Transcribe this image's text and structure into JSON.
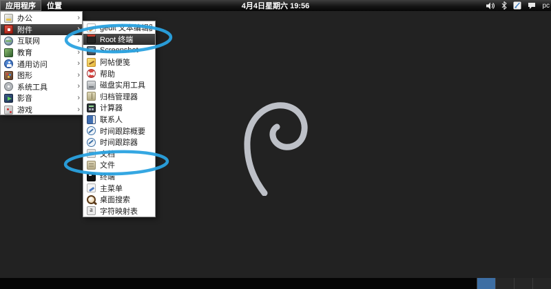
{
  "panel": {
    "applications_label": "应用程序",
    "places_label": "位置",
    "clock": "4月4日星期六 19:56",
    "tray": {
      "host_label": "pc",
      "icons": [
        "volume-icon",
        "bluetooth-icon",
        "input-pen-icon",
        "chat-icon"
      ]
    }
  },
  "desktop": {
    "logo": "debian-swirl-logo"
  },
  "menu": {
    "categories": [
      {
        "id": "office",
        "label": "办公",
        "icon": "office",
        "selected": false
      },
      {
        "id": "accessories",
        "label": "附件",
        "icon": "accessories",
        "selected": true
      },
      {
        "id": "internet",
        "label": "互联网",
        "icon": "internet",
        "selected": false
      },
      {
        "id": "education",
        "label": "教育",
        "icon": "education",
        "selected": false
      },
      {
        "id": "universal-access",
        "label": "通用访问",
        "icon": "universal-access",
        "selected": false
      },
      {
        "id": "graphics",
        "label": "图形",
        "icon": "graphics",
        "selected": false
      },
      {
        "id": "system-tools",
        "label": "系统工具",
        "icon": "system-tools",
        "selected": false
      },
      {
        "id": "sound-video",
        "label": "影音",
        "icon": "sound-video",
        "selected": false
      },
      {
        "id": "games",
        "label": "游戏",
        "icon": "games",
        "selected": false
      }
    ],
    "submenu": [
      {
        "id": "gedit-text-editor",
        "label": "gedit 文本编辑器",
        "icon": "gedit-text-editor",
        "selected": false
      },
      {
        "id": "root-terminal",
        "label": "Root 终端",
        "icon": "root-terminal",
        "selected": true
      },
      {
        "id": "screenshot",
        "label": "Screenshot",
        "icon": "screenshot",
        "selected": false
      },
      {
        "id": "xpad-notes",
        "label": "阿帖便笺",
        "icon": "xpad-notes",
        "selected": false
      },
      {
        "id": "help",
        "label": "帮助",
        "icon": "help",
        "selected": false
      },
      {
        "id": "disk-utility",
        "label": "磁盘实用工具",
        "icon": "disk-utility",
        "selected": false
      },
      {
        "id": "archive-manager",
        "label": "归档管理器",
        "icon": "archive-manager",
        "selected": false
      },
      {
        "id": "calculator",
        "label": "计算器",
        "icon": "calculator",
        "selected": false
      },
      {
        "id": "contacts",
        "label": "联系人",
        "icon": "contacts",
        "selected": false
      },
      {
        "id": "time-tracking-summary",
        "label": "时间跟踪概要",
        "icon": "time",
        "selected": false
      },
      {
        "id": "time-tracker",
        "label": "时间跟踪器",
        "icon": "time",
        "selected": false
      },
      {
        "id": "documents",
        "label": "文档",
        "icon": "documents",
        "selected": false
      },
      {
        "id": "files",
        "label": "文件",
        "icon": "files",
        "selected": false
      },
      {
        "id": "terminal",
        "label": "终端",
        "icon": "terminal",
        "selected": false
      },
      {
        "id": "main-menu",
        "label": "主菜单",
        "icon": "main-menu",
        "selected": false
      },
      {
        "id": "desktop-search",
        "label": "桌面搜索",
        "icon": "desktop-search",
        "selected": false
      },
      {
        "id": "character-map",
        "label": "字符映射表",
        "icon": "character-map",
        "selected": false
      }
    ]
  },
  "workspaces": {
    "count": 4,
    "active": 0
  },
  "annotations": {
    "color": "#2aa2e0",
    "highlighted_items": [
      "Root 终端",
      "文件"
    ]
  }
}
